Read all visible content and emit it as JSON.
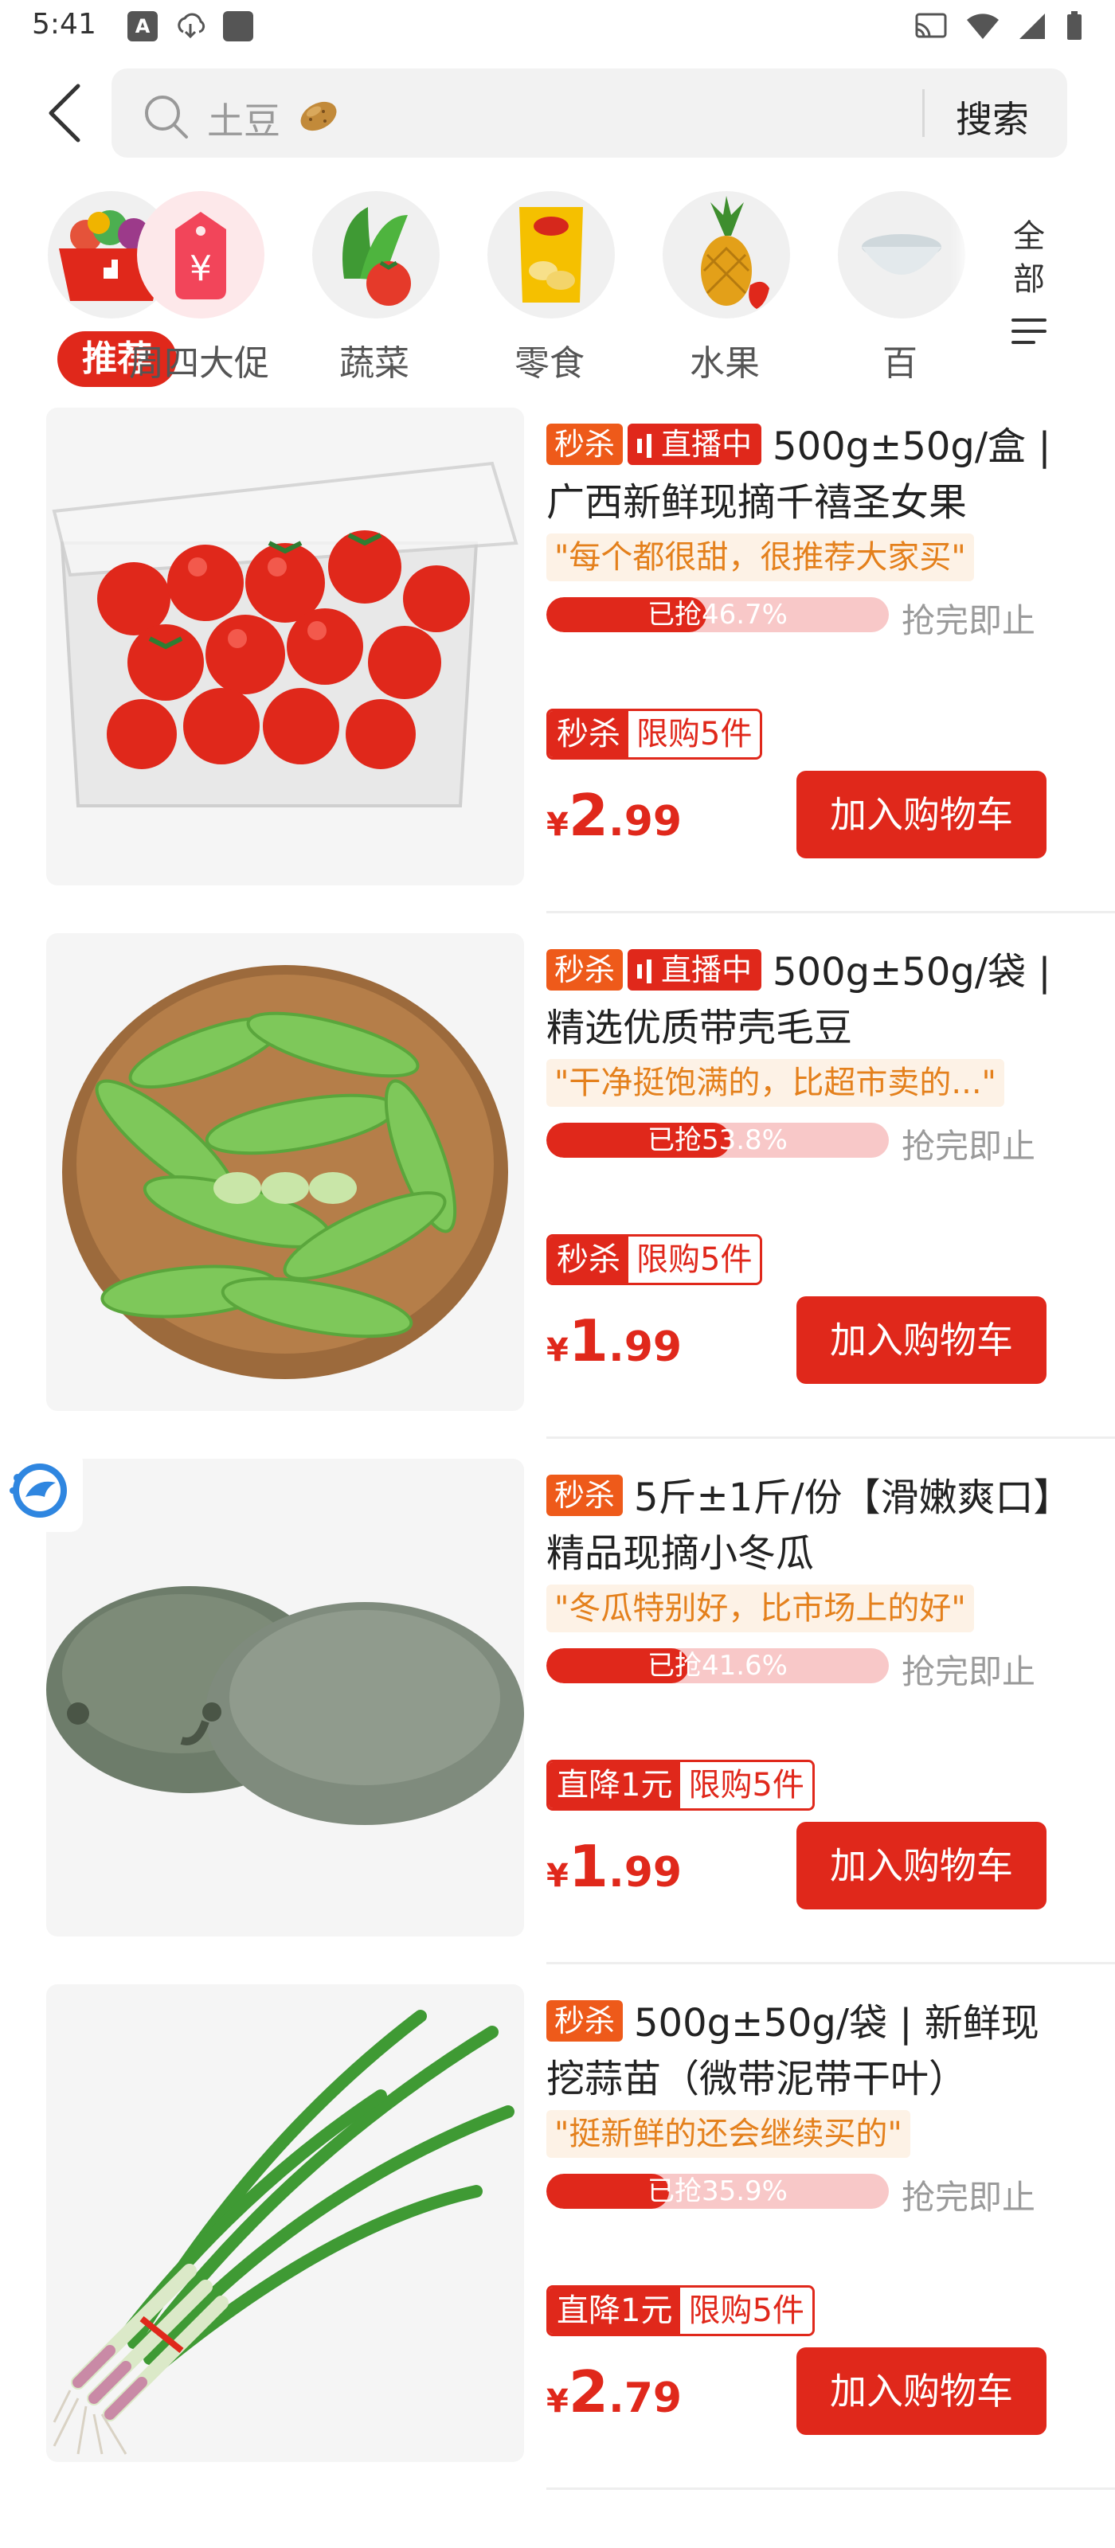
{
  "status_bar": {
    "time": "5:41",
    "left_icons": [
      "a-icon",
      "download-icon",
      "app-icon"
    ],
    "right_icons": [
      "cast-icon",
      "wifi-icon",
      "signal-icon",
      "battery-icon"
    ]
  },
  "search": {
    "placeholder": "土豆",
    "button_label": "搜索"
  },
  "categories": [
    {
      "label": "推荐",
      "active": true
    },
    {
      "label": "周四大促"
    },
    {
      "label": "蔬菜"
    },
    {
      "label": "零食"
    },
    {
      "label": "水果"
    },
    {
      "label": "百"
    }
  ],
  "all_label": "全部",
  "products": [
    {
      "tag": "秒杀",
      "live": "直播中",
      "title": "500g±50g/盒 | 广西新鲜现摘千禧圣女果",
      "quote": "\"每个都很甜，很推荐大家买\"",
      "progress_text": "已抢46.7%",
      "progress": 0.467,
      "progress_note": "抢完即止",
      "limit_main": "秒杀",
      "limit_sub": "限购5件",
      "price_symbol": "¥",
      "price_int": "2",
      "price_dec": ".99",
      "cart_label": "加入购物车"
    },
    {
      "tag": "秒杀",
      "live": "直播中",
      "title": "500g±50g/袋 | 精选优质带壳毛豆",
      "quote": "\"干净挺饱满的，比超市卖的...\"",
      "progress_text": "已抢53.8%",
      "progress": 0.538,
      "progress_note": "抢完即止",
      "limit_main": "秒杀",
      "limit_sub": "限购5件",
      "price_symbol": "¥",
      "price_int": "1",
      "price_dec": ".99",
      "cart_label": "加入购物车"
    },
    {
      "tag": "秒杀",
      "live": "",
      "title": "5斤±1斤/份【滑嫩爽口】精品现摘小冬瓜",
      "quote": "\"冬瓜特别好，比市场上的好\"",
      "progress_text": "已抢41.6%",
      "progress": 0.416,
      "progress_note": "抢完即止",
      "limit_main": "直降1元",
      "limit_sub": "限购5件",
      "price_symbol": "¥",
      "price_int": "1",
      "price_dec": ".99",
      "cart_label": "加入购物车"
    },
    {
      "tag": "秒杀",
      "live": "",
      "title": "500g±50g/袋 | 新鲜现挖蒜苗（微带泥带干叶）",
      "quote": "\"挺新鲜的还会继续买的\"",
      "progress_text": "已抢35.9%",
      "progress": 0.359,
      "progress_note": "抢完即止",
      "limit_main": "直降1元",
      "limit_sub": "限购5件",
      "price_symbol": "¥",
      "price_int": "2",
      "price_dec": ".79",
      "cart_label": "加入购物车"
    }
  ],
  "colors": {
    "accent": "#e0281b",
    "tag_orange": "#ee5a1a",
    "quote_text": "#e4801c",
    "quote_bg": "#fdf2e6",
    "progress_track": "#f8c8c8"
  }
}
